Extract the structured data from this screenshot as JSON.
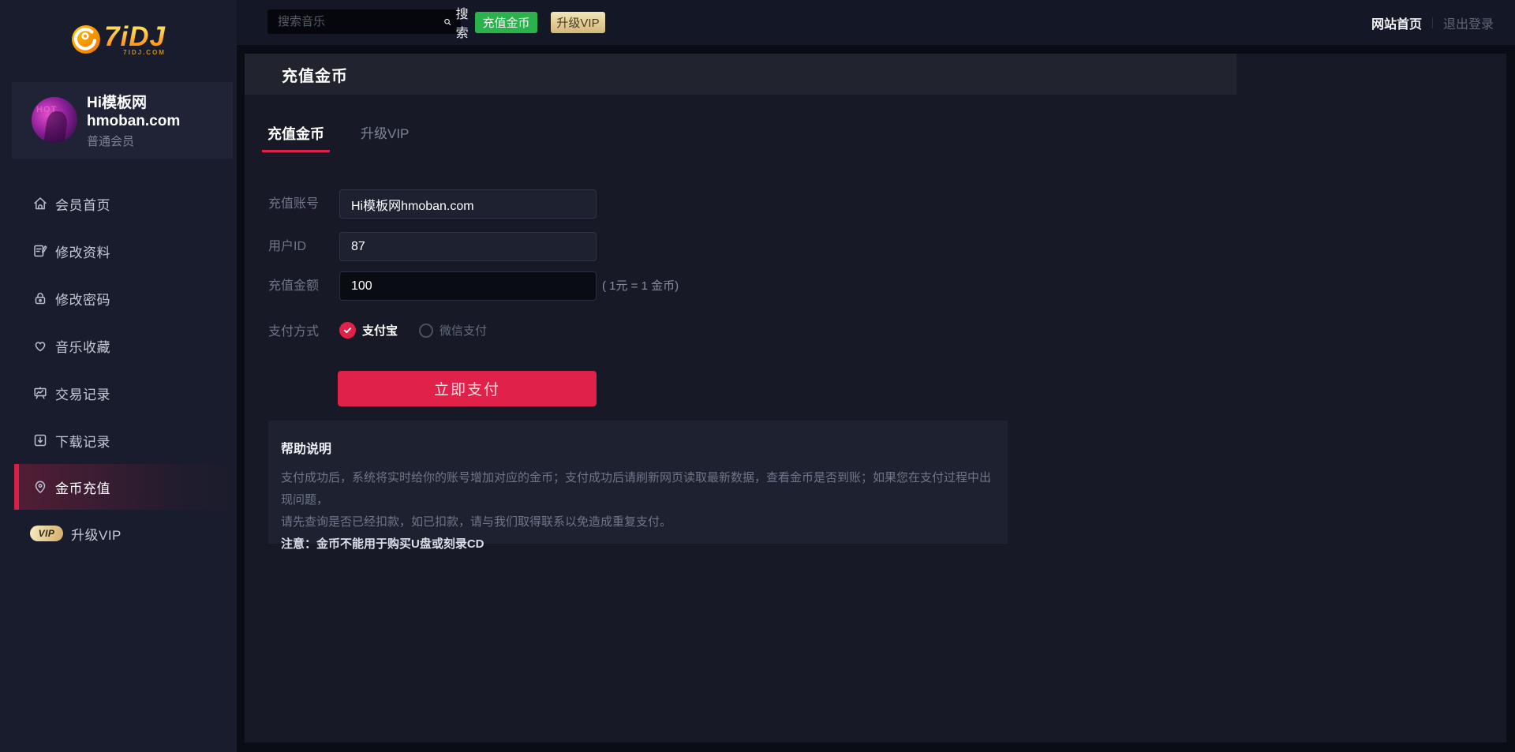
{
  "brand": {
    "logo_text": "7iDJ",
    "logo_domain": "7IDJ.COM"
  },
  "topbar": {
    "search_placeholder": "搜索音乐",
    "search_button_label": "搜索",
    "search_icon": "magnifier-icon",
    "recharge_button_label": "充值金币",
    "vip_button_label": "升级VIP",
    "home_link": "网站首页",
    "logout_link": "退出登录"
  },
  "profile": {
    "name_line1": "Hi模板网",
    "name_line2": "hmoban.com",
    "level": "普通会员",
    "avatar": "user-photo-avatar"
  },
  "sidebar": {
    "items": [
      {
        "label": "会员首页",
        "icon": "home-icon",
        "active": false
      },
      {
        "label": "修改资料",
        "icon": "profile-edit-icon",
        "active": false
      },
      {
        "label": "修改密码",
        "icon": "lock-icon",
        "active": false
      },
      {
        "label": "音乐收藏",
        "icon": "heart-icon",
        "active": false
      },
      {
        "label": "交易记录",
        "icon": "chart-board-icon",
        "active": false
      },
      {
        "label": "下载记录",
        "icon": "download-icon",
        "active": false
      },
      {
        "label": "金币充值",
        "icon": "coin-pin-icon",
        "active": true
      },
      {
        "label": "升级VIP",
        "icon": "vip-badge-icon",
        "active": false,
        "badge": "VIP"
      }
    ]
  },
  "main": {
    "page_title": "充值金币",
    "tabs": [
      {
        "label": "充值金币",
        "active": true
      },
      {
        "label": "升级VIP",
        "active": false
      }
    ],
    "form": {
      "fields": [
        {
          "label": "充值账号",
          "value": "Hi模板网hmoban.com"
        },
        {
          "label": "用户ID",
          "value": "87"
        },
        {
          "label": "充值金额",
          "value": "100",
          "note": "( 1元 = 1 金币)"
        }
      ],
      "payment": {
        "label": "支付方式",
        "options": [
          {
            "label": "支付宝",
            "checked": true
          },
          {
            "label": "微信支付",
            "checked": false
          }
        ]
      },
      "submit_label": "立即支付"
    },
    "help": {
      "title": "帮助说明",
      "lines": [
        "支付成功后，系统将实时给你的账号增加对应的金币；支付成功后请刷新网页读取最新数据，查看金币是否到账；如果您在支付过程中出现问题，",
        "请先查询是否已经扣款，如已扣款，请与我们取得联系以免造成重复支付。"
      ],
      "warning": "注意：金币不能用于购买U盘或刻录CD"
    }
  },
  "colors": {
    "accent_red": "#e0214a",
    "green_button": "#2bb24d",
    "gold_button": "#d3b77a",
    "sidebar_bg": "#191c2c",
    "panel_bg": "#171a26",
    "panel_header_bg": "#21242f",
    "page_bg": "#0b0d14",
    "help_box_bg": "#1d2130",
    "logo_gold": "#ff9518"
  }
}
